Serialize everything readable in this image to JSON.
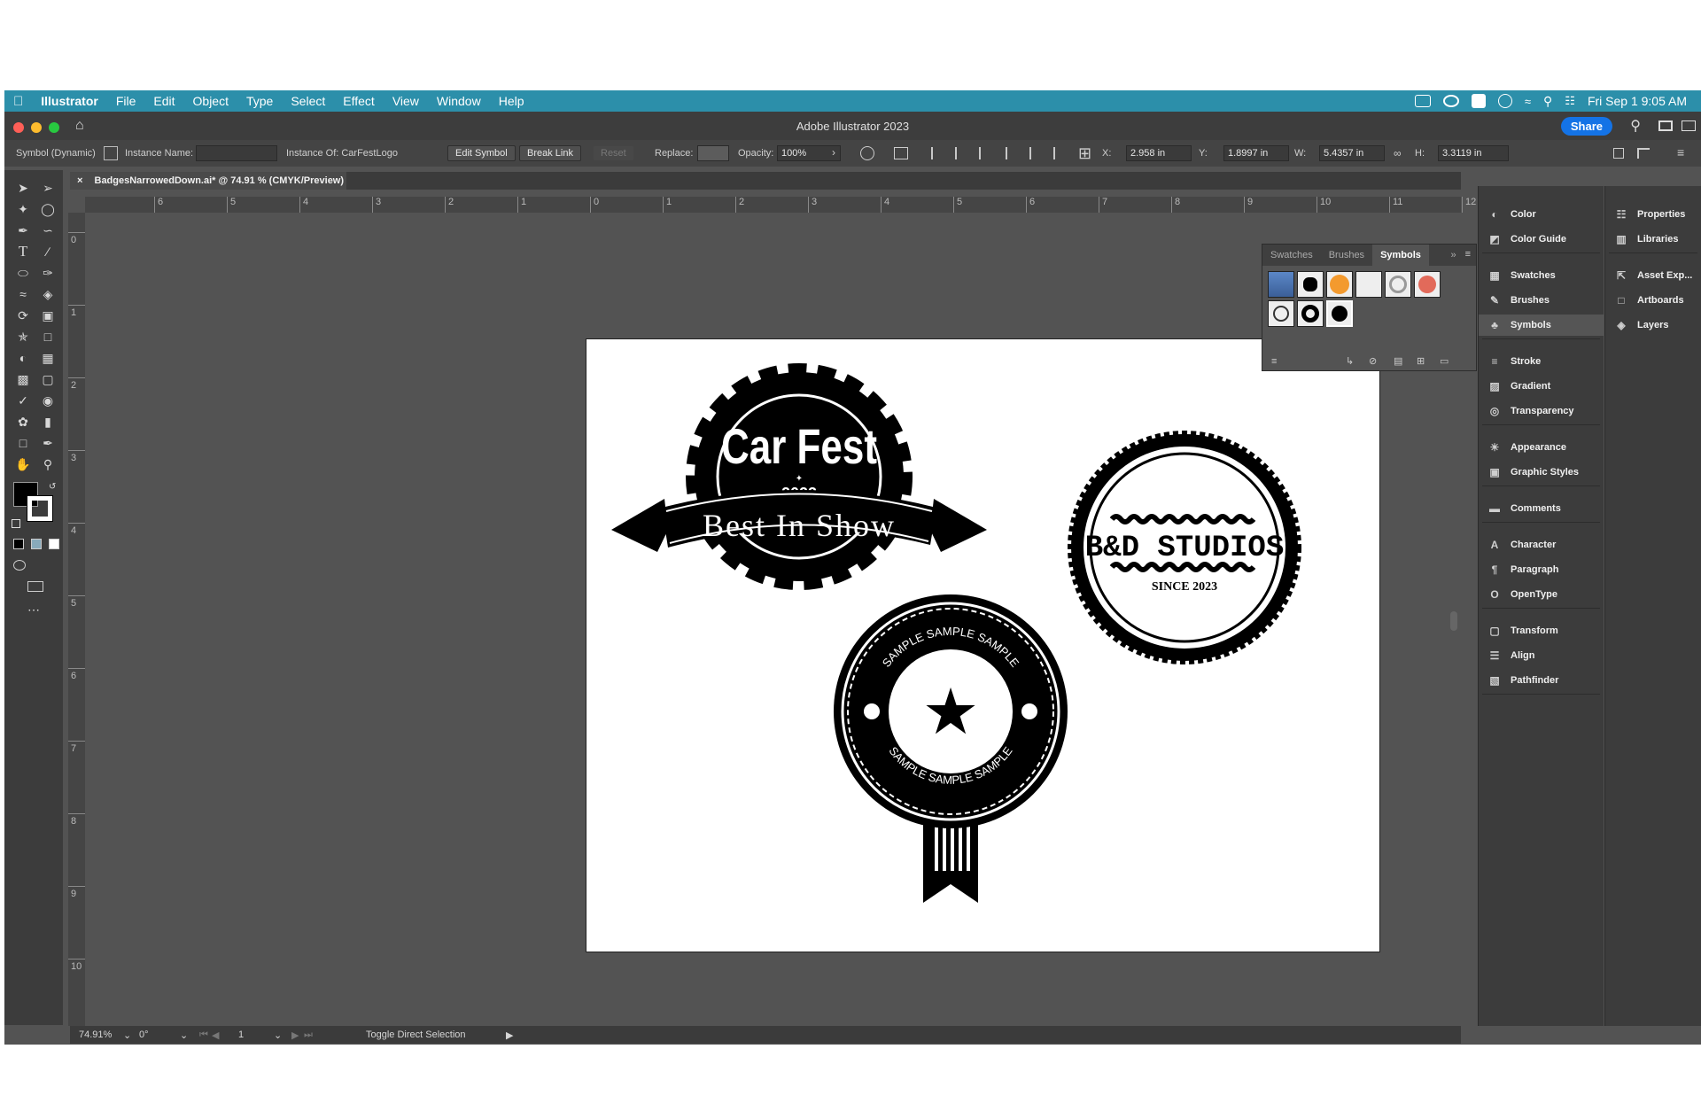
{
  "menubar": {
    "app_name": "Illustrator",
    "items": [
      "File",
      "Edit",
      "Object",
      "Type",
      "Select",
      "Effect",
      "View",
      "Window",
      "Help"
    ],
    "clock": "Fri Sep 1  9:05 AM"
  },
  "titlebar": {
    "title": "Adobe Illustrator 2023",
    "share_label": "Share"
  },
  "controlbar": {
    "selection_type": "Symbol (Dynamic)",
    "instance_name_label": "Instance Name:",
    "instance_name_value": "",
    "instance_of": "Instance Of: CarFestLogo",
    "edit_symbol": "Edit Symbol",
    "break_link": "Break Link",
    "reset": "Reset",
    "replace_label": "Replace:",
    "opacity_label": "Opacity:",
    "opacity_value": "100%",
    "x_label": "X:",
    "x_value": "2.958 in",
    "y_label": "Y:",
    "y_value": "1.8997 in",
    "w_label": "W:",
    "w_value": "5.4357 in",
    "h_label": "H:",
    "h_value": "3.3119 in"
  },
  "document": {
    "tab_title": "BadgesNarrowedDown.ai* @ 74.91 % (CMYK/Preview)"
  },
  "rulers": {
    "horizontal": [
      "6",
      "5",
      "4",
      "3",
      "2",
      "1",
      "0",
      "1",
      "2",
      "3",
      "4",
      "5",
      "6",
      "7",
      "8",
      "9",
      "10",
      "11",
      "12"
    ],
    "vertical": [
      "0",
      "1",
      "2",
      "3",
      "4",
      "5",
      "6",
      "7",
      "8",
      "9",
      "10"
    ]
  },
  "artwork": {
    "car_fest": {
      "title": "Car Fest",
      "year": "2023",
      "banner": "Best In Show"
    },
    "bd_studios": {
      "name": "B&D STUDIOS",
      "since": "SINCE 2023"
    },
    "sample_badge": {
      "top_text": "SAMPLE SAMPLE SAMPLE",
      "bottom_text": "SAMPLE SAMPLE SAMPLE"
    }
  },
  "symbols_panel": {
    "tabs": [
      "Swatches",
      "Brushes",
      "Symbols"
    ],
    "active_tab": "Symbols"
  },
  "dock": {
    "column1": [
      {
        "label": "Color",
        "icon": "color-icon"
      },
      {
        "label": "Color Guide",
        "icon": "color-guide-icon"
      },
      {
        "label": "Swatches",
        "icon": "swatches-icon"
      },
      {
        "label": "Brushes",
        "icon": "brushes-icon"
      },
      {
        "label": "Symbols",
        "icon": "symbols-icon"
      },
      {
        "label": "Stroke",
        "icon": "stroke-icon"
      },
      {
        "label": "Gradient",
        "icon": "gradient-icon"
      },
      {
        "label": "Transparency",
        "icon": "transparency-icon"
      },
      {
        "label": "Appearance",
        "icon": "appearance-icon"
      },
      {
        "label": "Graphic Styles",
        "icon": "graphic-styles-icon"
      },
      {
        "label": "Comments",
        "icon": "comments-icon"
      },
      {
        "label": "Character",
        "icon": "character-icon"
      },
      {
        "label": "Paragraph",
        "icon": "paragraph-icon"
      },
      {
        "label": "OpenType",
        "icon": "opentype-icon"
      },
      {
        "label": "Transform",
        "icon": "transform-icon"
      },
      {
        "label": "Align",
        "icon": "align-icon"
      },
      {
        "label": "Pathfinder",
        "icon": "pathfinder-icon"
      }
    ],
    "column2": [
      {
        "label": "Properties",
        "icon": "properties-icon"
      },
      {
        "label": "Libraries",
        "icon": "libraries-icon"
      },
      {
        "label": "Asset Exp...",
        "icon": "asset-export-icon"
      },
      {
        "label": "Artboards",
        "icon": "artboards-icon"
      },
      {
        "label": "Layers",
        "icon": "layers-icon"
      }
    ]
  },
  "statusbar": {
    "zoom": "74.91%",
    "rotation": "0°",
    "artboard_number": "1",
    "status_text": "Toggle Direct Selection"
  },
  "colors": {
    "menubar": "#2c8faa",
    "share_button": "#1473e6",
    "ui_dark": "#3c3c3c",
    "canvas": "#535353"
  }
}
